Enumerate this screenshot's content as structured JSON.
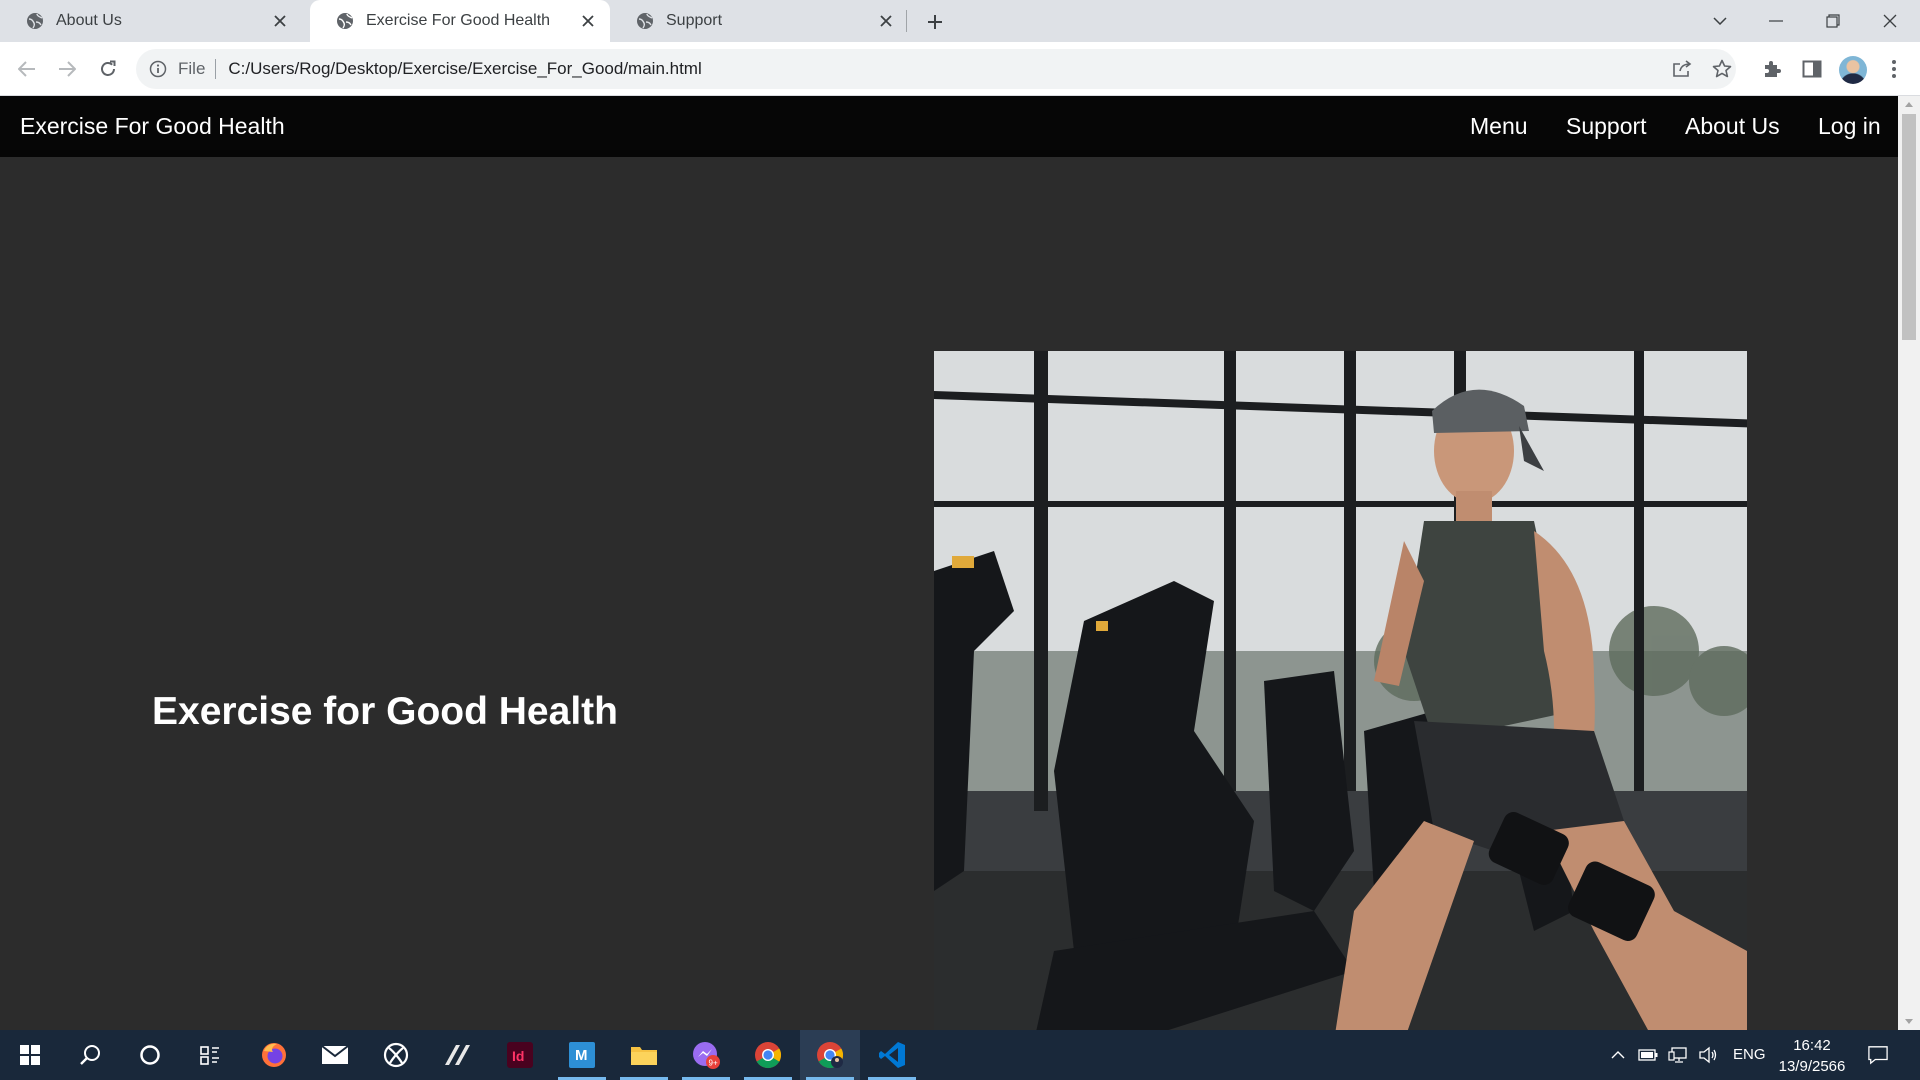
{
  "browser": {
    "tabs": [
      {
        "title": "About Us",
        "favicon": "globe-icon",
        "active": false
      },
      {
        "title": "Exercise For Good Health",
        "favicon": "globe-icon",
        "active": true
      },
      {
        "title": "Support",
        "favicon": "globe-icon",
        "active": false
      }
    ],
    "address": {
      "scheme_label": "File",
      "url": "C:/Users/Rog/Desktop/Exercise/Exercise_For_Good/main.html"
    }
  },
  "page": {
    "navbar": {
      "brand": "Exercise For Good Health",
      "links": [
        "Menu",
        "Support",
        "About Us",
        "Log in"
      ]
    },
    "hero": {
      "title": "Exercise for Good Health",
      "image": "gym-man-lunge-with-dumbbells-photo"
    }
  },
  "taskbar": {
    "apps": [
      "windows-start-icon",
      "search-icon",
      "cortana-icon",
      "task-view-icon",
      "firefox-icon",
      "mail-icon",
      "xbox-icon",
      "stylus-app-icon",
      "indesign-icon",
      "app-m-icon",
      "file-explorer-icon",
      "messenger-icon",
      "chrome-icon",
      "chrome-profile-icon",
      "vscode-icon"
    ],
    "tray": {
      "language": "ENG",
      "time": "16:42",
      "date": "13/9/2566"
    }
  },
  "colors": {
    "page_bg": "#2c2c2c",
    "navbar_bg": "#060606",
    "tabstrip_bg": "#dee1e6",
    "taskbar_bg": "#19283a"
  }
}
